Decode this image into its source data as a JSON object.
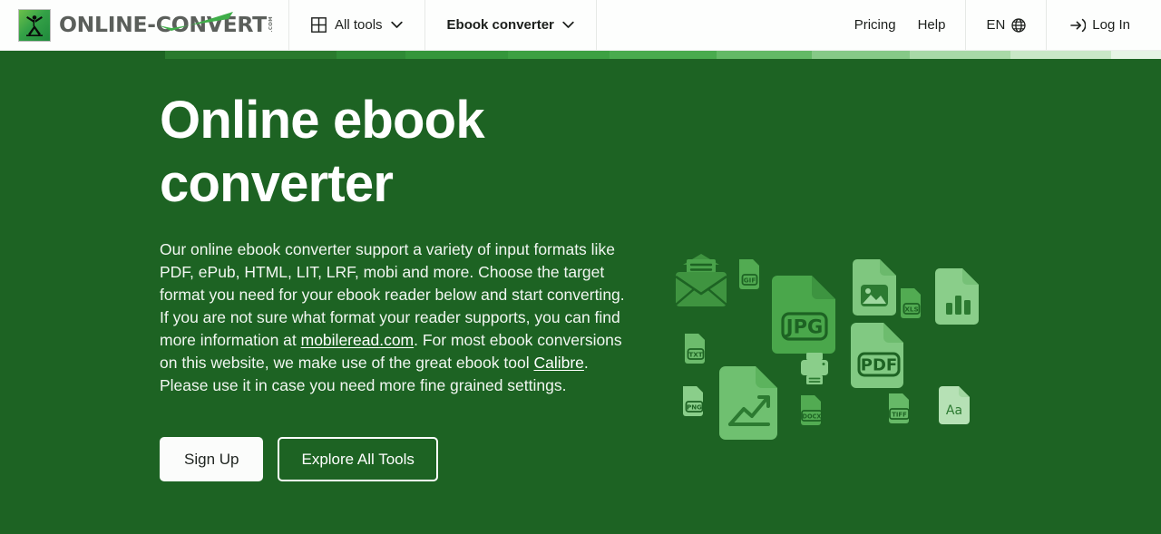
{
  "header": {
    "logo": {
      "mark_icon": "runner-icon",
      "word_a": "ONLINE-",
      "word_b": "CONVERT",
      "dotcom": ".COM"
    },
    "nav": [
      {
        "label": "All tools",
        "icon": "grid-icon",
        "chevron": "chevron-down-icon"
      },
      {
        "label": "Ebook converter",
        "chevron": "chevron-down-icon"
      }
    ],
    "links": [
      {
        "label": "Pricing"
      },
      {
        "label": "Help"
      }
    ],
    "language": {
      "label": "EN",
      "icon": "globe-icon"
    },
    "login": {
      "label": "Log In",
      "icon": "login-arrow-icon"
    }
  },
  "hero": {
    "background_color": "#1d6323",
    "title": "Online ebook converter",
    "paragraph": {
      "part1": "Our online ebook converter support a variety of input formats like PDF, ePub, HTML, LIT, LRF, mobi and more. Choose the target format you need for your ebook reader below and start converting. If you are not sure what format your reader supports, you can find more information at ",
      "link1": "mobileread.com",
      "part2": ". For most ebook conversions on this website, we make use of the great ebook tool ",
      "link2": "Calibre",
      "part3": ". Please use it in case you need more fine grained settings."
    },
    "buttons": {
      "primary": "Sign Up",
      "secondary": "Explore All Tools"
    },
    "top_strip_colors": [
      "#1d6323",
      "#2a7a2e",
      "#2f8a36",
      "#35963b",
      "#3da042",
      "#49ab4e",
      "#63b966",
      "#86c987",
      "#a8d9a7",
      "#c9e8c7",
      "#e6f4e5"
    ],
    "illustration": {
      "label": "file-format-icons-illustration",
      "items": [
        {
          "name": "envelope-icon",
          "label": ""
        },
        {
          "name": "file-gif-icon",
          "label": "GIF"
        },
        {
          "name": "file-jpg-icon",
          "label": "JPG"
        },
        {
          "name": "file-image-icon",
          "label": ""
        },
        {
          "name": "file-xls-icon",
          "label": "XLS"
        },
        {
          "name": "file-chart-bar-icon",
          "label": ""
        },
        {
          "name": "file-txt-icon",
          "label": "TXT"
        },
        {
          "name": "file-pdf-icon",
          "label": "PDF"
        },
        {
          "name": "printer-icon",
          "label": ""
        },
        {
          "name": "file-png-icon",
          "label": "PNG"
        },
        {
          "name": "file-chart-line-icon",
          "label": ""
        },
        {
          "name": "file-docx-icon",
          "label": "DOCX"
        },
        {
          "name": "file-tiff-icon",
          "label": "TIFF"
        },
        {
          "name": "file-font-icon",
          "label": "Aa"
        }
      ]
    }
  }
}
